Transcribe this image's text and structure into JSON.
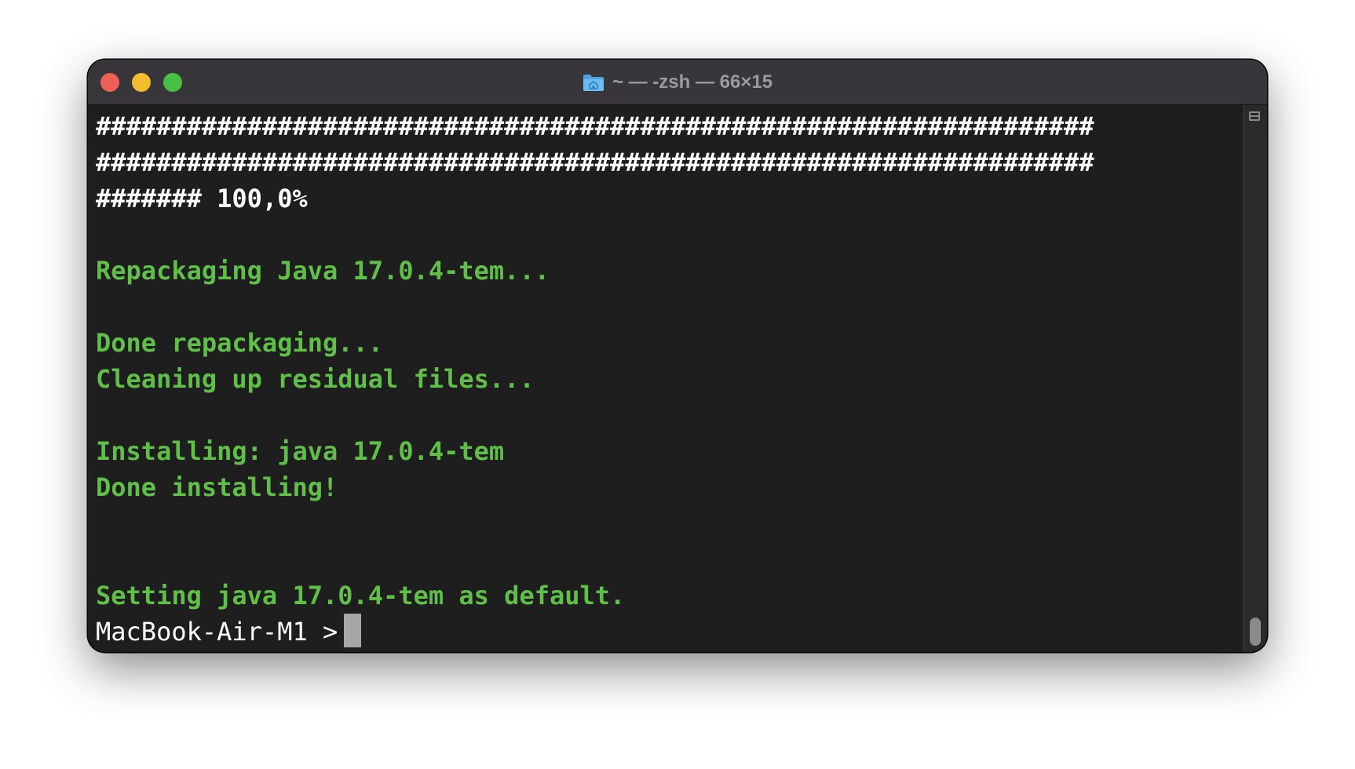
{
  "window": {
    "title": "~ — -zsh — 66×15"
  },
  "icons": {
    "title_folder": "home-folder-icon"
  },
  "colors": {
    "background": "#1e1e1e",
    "output_text": "#ffffff",
    "status_text": "#5fbf48",
    "cursor": "#a6a6a6",
    "close": "#ee5f56",
    "minimize": "#f3bd30",
    "zoom": "#47c043"
  },
  "terminal": {
    "lines": [
      {
        "text": "##################################################################",
        "style": "white"
      },
      {
        "text": "##################################################################",
        "style": "white"
      },
      {
        "text": "####### 100,0%",
        "style": "white"
      },
      {
        "text": "",
        "style": "white"
      },
      {
        "text": "Repackaging Java 17.0.4-tem...",
        "style": "green"
      },
      {
        "text": "",
        "style": "white"
      },
      {
        "text": "Done repackaging...",
        "style": "green"
      },
      {
        "text": "Cleaning up residual files...",
        "style": "green"
      },
      {
        "text": "",
        "style": "white"
      },
      {
        "text": "Installing: java 17.0.4-tem",
        "style": "green"
      },
      {
        "text": "Done installing!",
        "style": "green"
      },
      {
        "text": "",
        "style": "white"
      },
      {
        "text": "",
        "style": "white"
      },
      {
        "text": "Setting java 17.0.4-tem as default.",
        "style": "green"
      }
    ],
    "prompt": "MacBook-Air-M1 > "
  }
}
